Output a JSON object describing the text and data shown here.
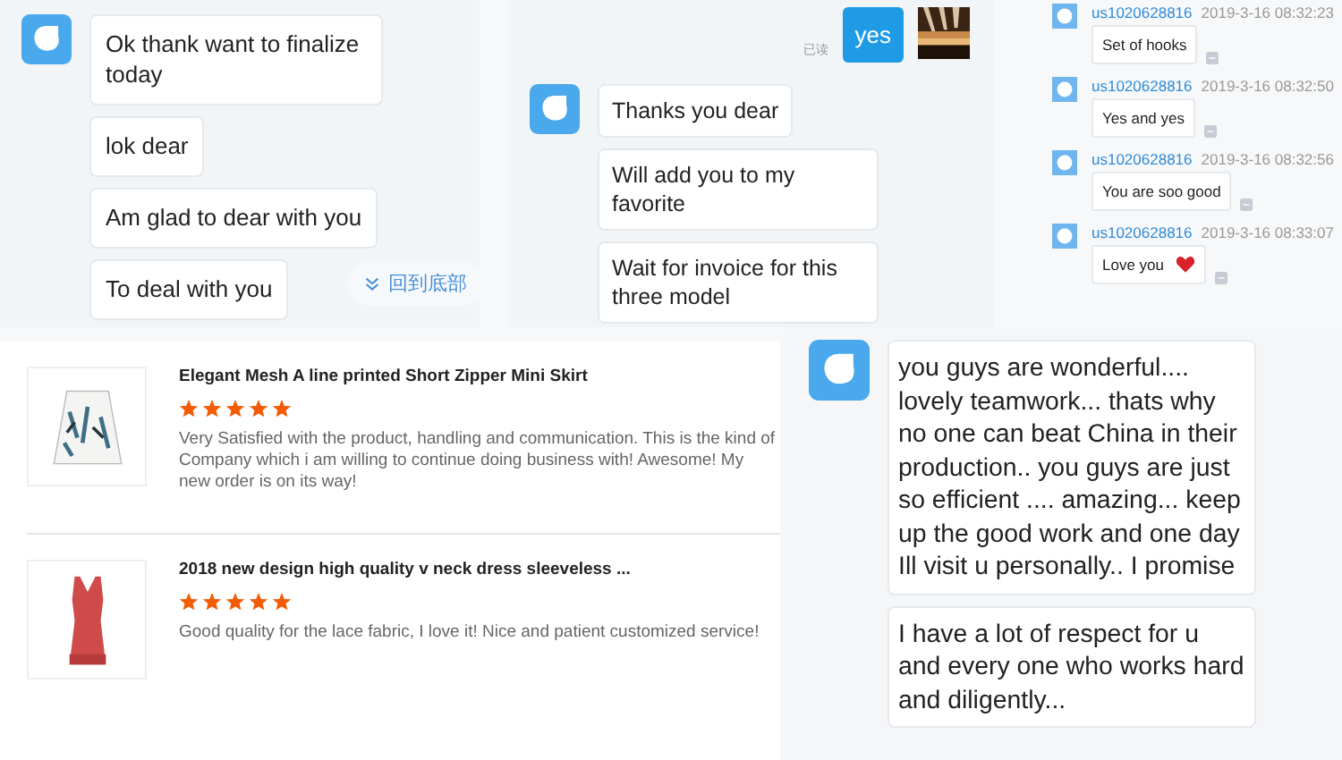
{
  "chat_a": {
    "messages": [
      {
        "text": "Ok thank want to finalize today"
      },
      {
        "text": "lok dear"
      },
      {
        "text": "Am glad to dear with you"
      },
      {
        "text": "To deal with you"
      }
    ],
    "jump_button": "回到底部"
  },
  "chat_b": {
    "sent": {
      "text": "yes",
      "receipt": "已读"
    },
    "messages": [
      {
        "text": "Thanks you dear"
      },
      {
        "text": "Will add you to my favorite"
      },
      {
        "text": "Wait for invoice for this three model"
      }
    ]
  },
  "chat_c": {
    "messages": [
      {
        "user": "us1020628816",
        "time": "2019-3-16 08:32:23",
        "text": "Set of hooks",
        "kind": "plain"
      },
      {
        "user": "us1020628816",
        "time": "2019-3-16 08:32:50",
        "text": "Yes and yes",
        "kind": "plain"
      },
      {
        "user": "us1020628816",
        "time": "2019-3-16 08:32:56",
        "text": "You are soo good",
        "kind": "plain"
      },
      {
        "user": "us1020628816",
        "time": "2019-3-16 08:33:07",
        "text": "Love you",
        "kind": "heart"
      }
    ]
  },
  "reviews": [
    {
      "title": "Elegant Mesh A line printed Short Zipper Mini Skirt",
      "stars": 5,
      "text": "Very Satisfied with the product, handling and communication. This is the kind of Company which i am willing to continue doing business with! Awesome! My new order is on its way!",
      "kind": "skirt"
    },
    {
      "title": "2018 new design high quality v neck dress sleeveless ...",
      "stars": 5,
      "text": "Good quality for the lace fabric, I love it! Nice and patient customized service!",
      "kind": "dress"
    }
  ],
  "chat_d": {
    "messages": [
      {
        "text": " you guys are wonderful.... lovely teamwork... thats why no one can beat China in their production.. you guys are just so efficient .... amazing... keep up the good work and one day Ill visit u personally.. I promise"
      },
      {
        "text": "I have a lot of respect for u and every one who works hard and diligently..."
      }
    ]
  }
}
